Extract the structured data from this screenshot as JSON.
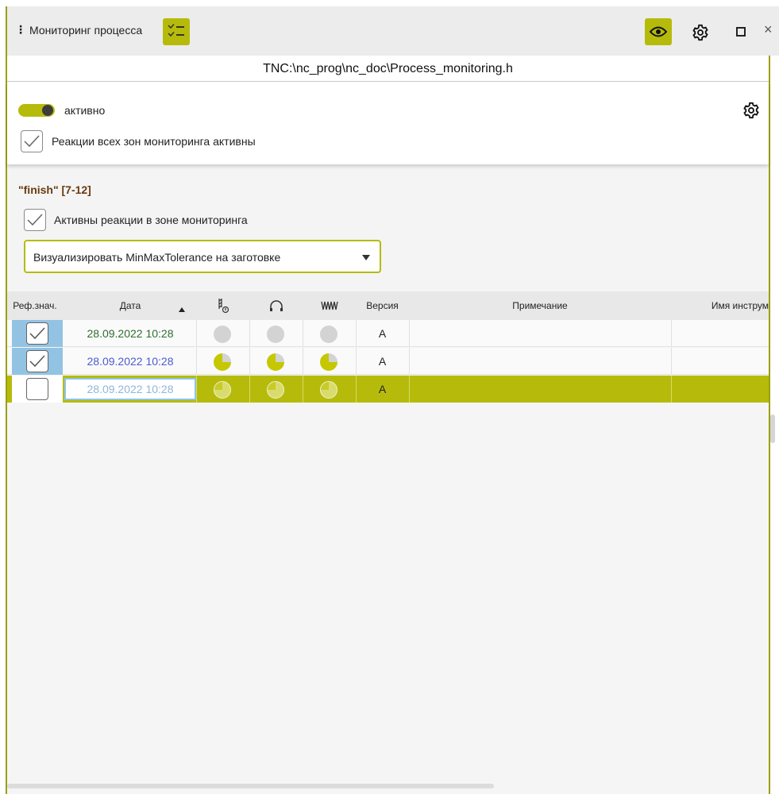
{
  "window": {
    "title": "Мониторинг процесса",
    "drag_handle": "⋮",
    "close": "×"
  },
  "path": "TNC:\\nc_prog\\nc_doc\\Process_monitoring.h",
  "monitoring": {
    "toggle_label": "активно",
    "toggle_on": true,
    "all_zones_label": "Реакции всех зон мониторинга активны",
    "all_zones_checked": true
  },
  "zone": {
    "title": "\"finish\" [7-12]",
    "reactions_label": "Активны реакции в зоне мониторинга",
    "reactions_checked": true,
    "visualize_select": "Визуализировать MinMaxTolerance на заготовке"
  },
  "table": {
    "columns": {
      "ref": "Реф.знач.",
      "date": "Дата",
      "version": "Версия",
      "note": "Примечание",
      "tool": "Имя инструм"
    },
    "rows": [
      {
        "ref_checked": true,
        "date": "28.09.2022 10:28",
        "date_color": "#2f6d2f",
        "version": "A",
        "note": "",
        "tool": "",
        "state": "gray"
      },
      {
        "ref_checked": true,
        "date": "28.09.2022 10:28",
        "date_color": "#4b5bd0",
        "version": "A",
        "note": "",
        "tool": "",
        "state": "yellow"
      },
      {
        "ref_checked": false,
        "date": "28.09.2022 10:28",
        "date_color": "#8fb6d9",
        "version": "A",
        "note": "",
        "tool": "",
        "state": "outline"
      }
    ]
  },
  "colors": {
    "accent": "#b6bb0b",
    "ref_cell": "#93c3e3"
  }
}
